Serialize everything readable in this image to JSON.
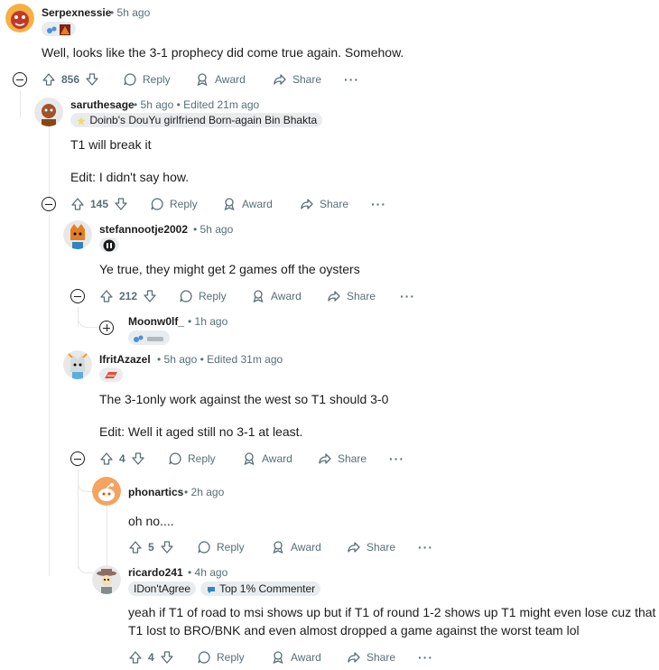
{
  "actions": {
    "reply": "Reply",
    "award": "Award",
    "share": "Share",
    "more": "···"
  },
  "comments": {
    "c1": {
      "user": "Serpexnessie",
      "meta": "• 5h ago",
      "body": [
        "Well, looks like the 3-1 prophecy did come true again. Somehow."
      ],
      "votes": "856"
    },
    "c2": {
      "user": "saruthesage",
      "meta": "• 5h ago • Edited 21m ago",
      "flair": "Doinb's DouYu girlfriend Born-again Bin Bhakta",
      "body": [
        "T1 will break it",
        "Edit: I didn't say how."
      ],
      "votes": "145"
    },
    "c3": {
      "user": "stefannootje2002",
      "meta": "• 5h ago",
      "body": [
        "Ye true, they might get 2 games off the oysters"
      ],
      "votes": "212"
    },
    "c4": {
      "user": "Moonw0lf_",
      "meta": "• 1h ago"
    },
    "c5": {
      "user": "IfritAzazel",
      "meta": "• 5h ago • Edited 31m ago",
      "body": [
        "The 3-1only work against the west so T1 should 3-0",
        "Edit: Well it aged still no 3-1 at least."
      ],
      "votes": "4"
    },
    "c6": {
      "user": "phonartics",
      "meta": "• 2h ago",
      "body": [
        "oh no...."
      ],
      "votes": "5"
    },
    "c7": {
      "user": "ricardo241",
      "meta": "• 4h ago",
      "flair1": "IDon'tAgree",
      "flair2": "Top 1% Commenter",
      "body": [
        "yeah if T1 of road to msi shows up but if T1 of round 1-2 shows up T1 might even lose cuz that",
        "T1 lost to BRO/BNK and even almost dropped a game against the worst team lol"
      ],
      "votes": "4"
    }
  },
  "colors": {
    "text": "#1c1c1c",
    "meta": "#576f76",
    "flair_bg": "#e9ecef",
    "thread": "#e5e7eb"
  }
}
